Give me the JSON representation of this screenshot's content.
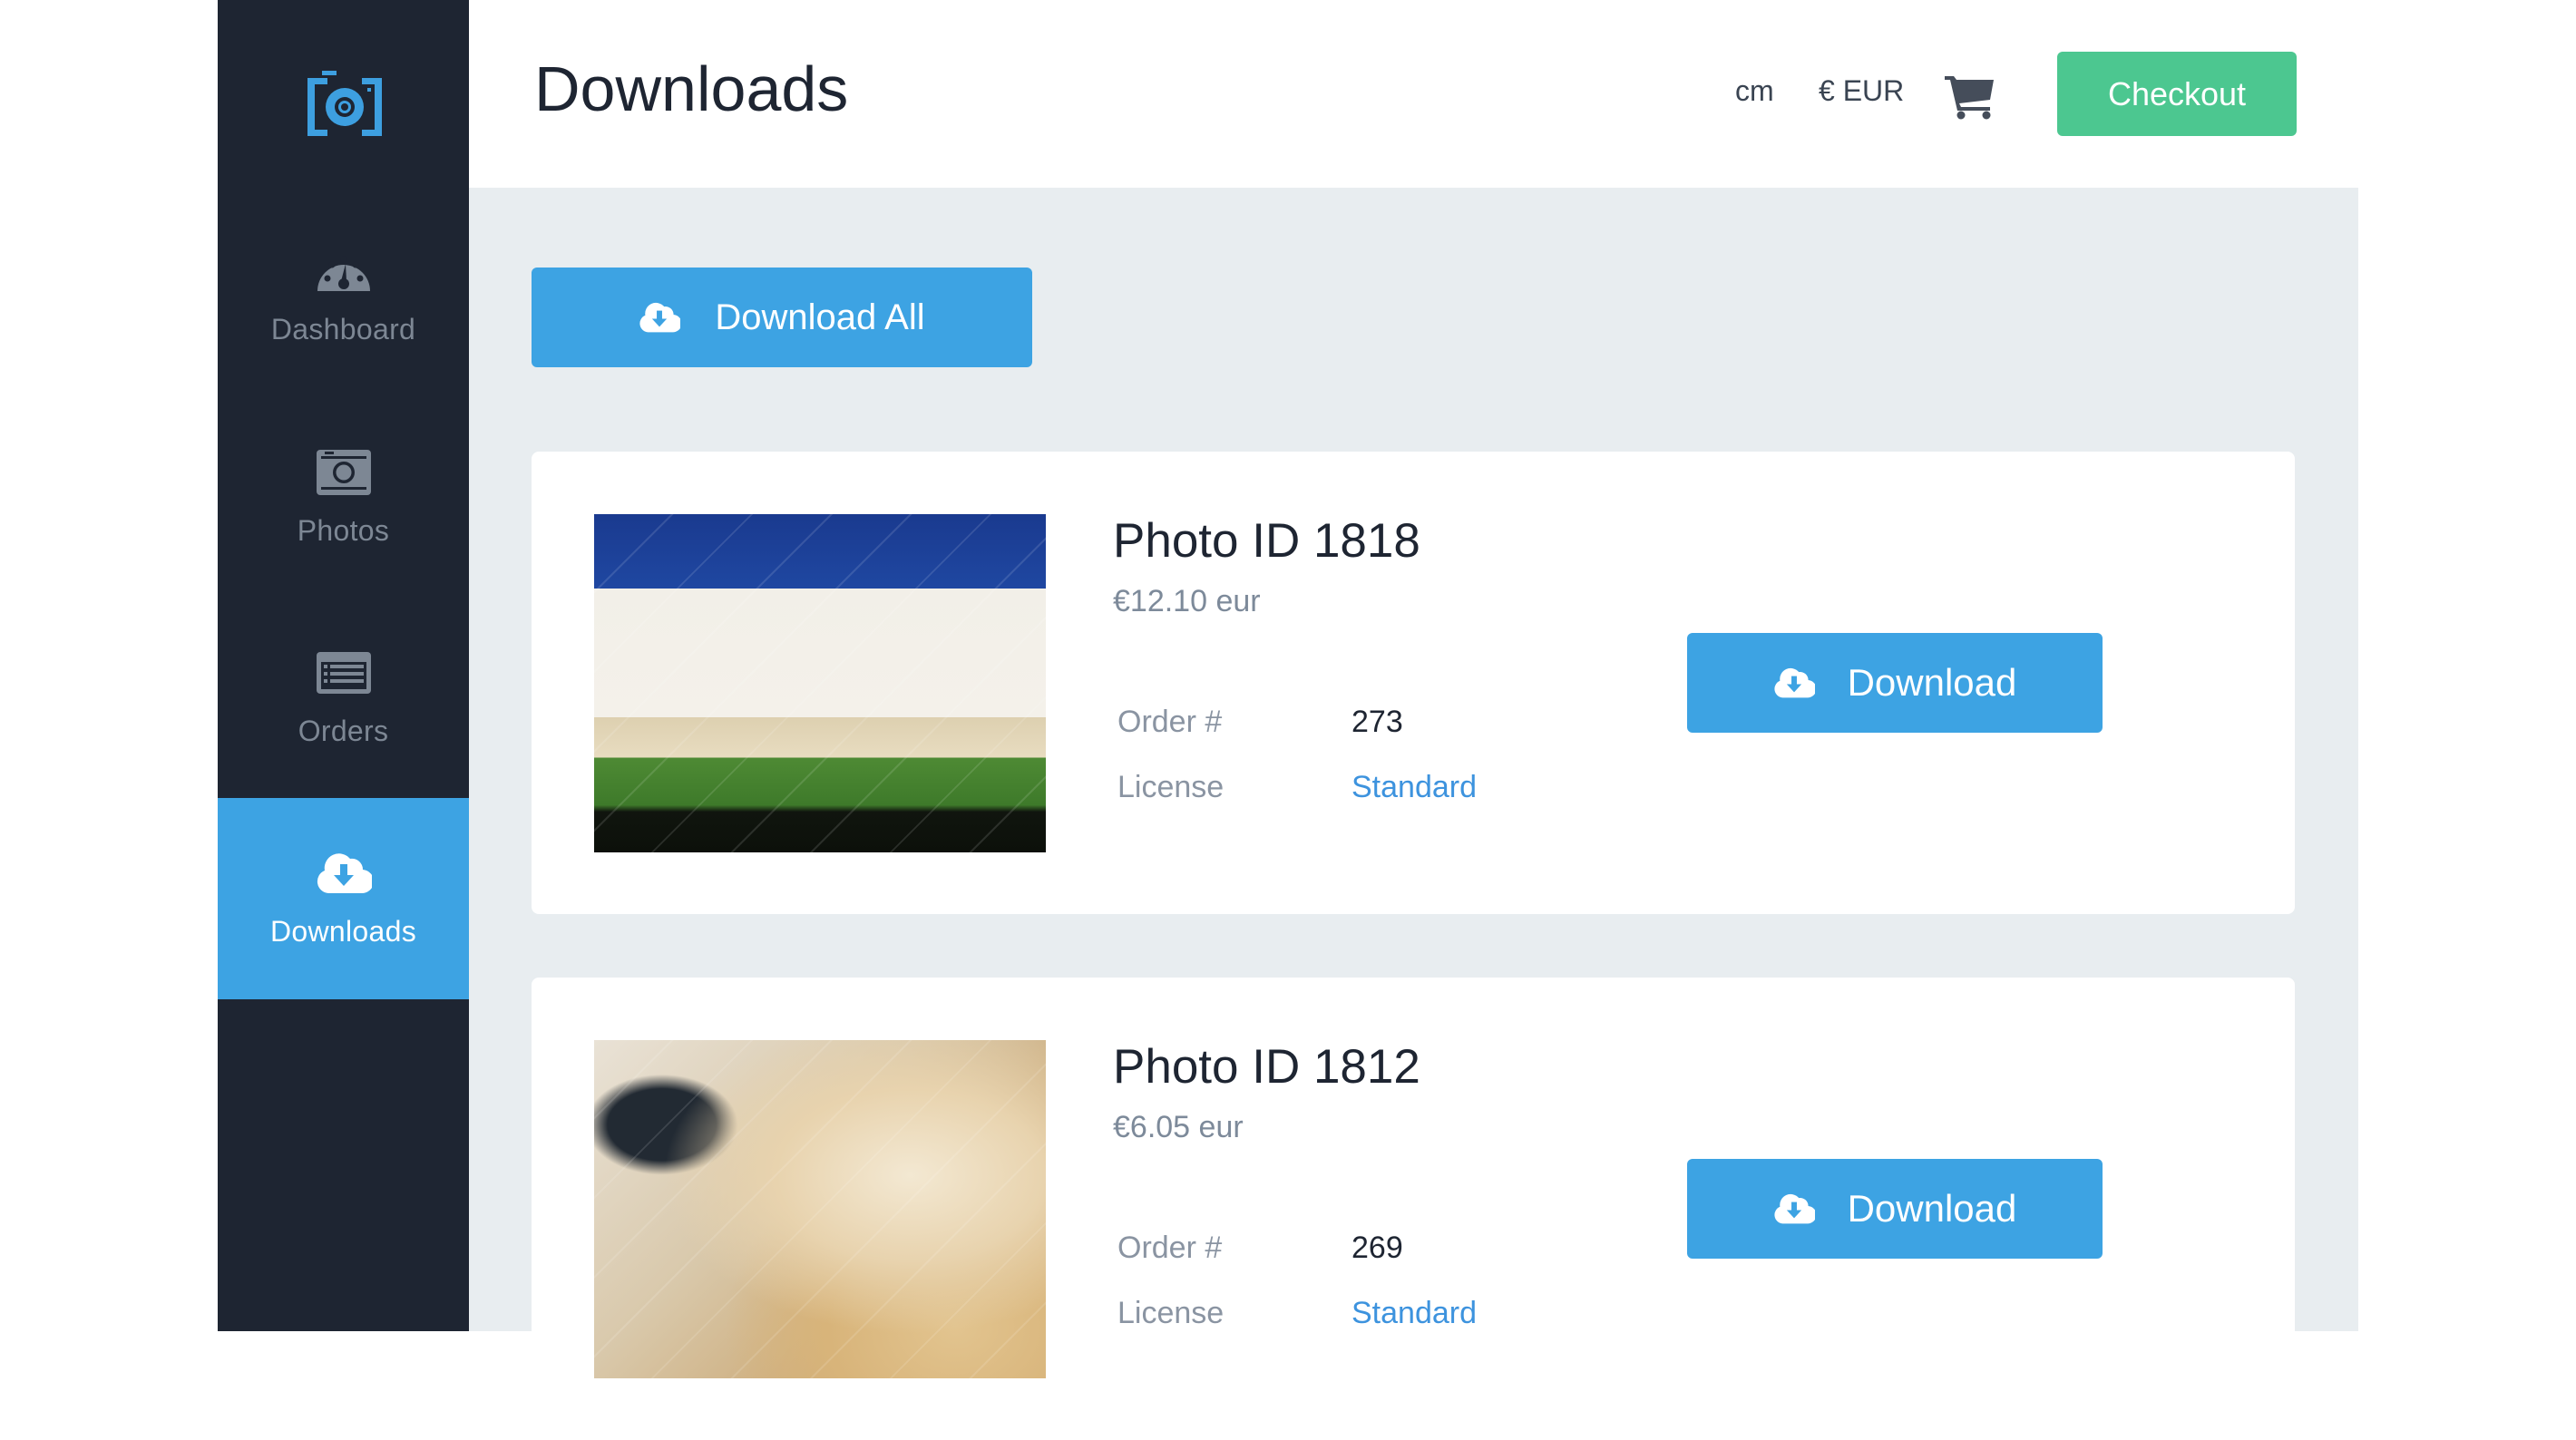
{
  "sidebar": {
    "logo": "camera-logo",
    "items": [
      {
        "label": "Dashboard",
        "icon": "dashboard-gauge-icon",
        "active": false
      },
      {
        "label": "Photos",
        "icon": "camera-icon",
        "active": false
      },
      {
        "label": "Orders",
        "icon": "list-icon",
        "active": false
      },
      {
        "label": "Downloads",
        "icon": "cloud-download-icon",
        "active": true
      }
    ]
  },
  "header": {
    "title": "Downloads",
    "units": "cm",
    "currency": "€ EUR",
    "cart_icon": "shopping-cart-icon",
    "checkout_label": "Checkout"
  },
  "main": {
    "download_all_label": "Download All",
    "downloads": [
      {
        "title": "Photo ID 1818",
        "price": "€12.10 eur",
        "order_label": "Order #",
        "order_number": "273",
        "license_label": "License",
        "license_value": "Standard",
        "download_label": "Download"
      },
      {
        "title": "Photo ID 1812",
        "price": "€6.05 eur",
        "order_label": "Order #",
        "order_number": "269",
        "license_label": "License",
        "license_value": "Standard",
        "download_label": "Download"
      }
    ]
  },
  "colors": {
    "sidebar_bg": "#1e2532",
    "accent_blue": "#3da3e3",
    "checkout_green": "#4cc790",
    "content_bg": "#e8edf0",
    "link_blue": "#3d93de"
  }
}
